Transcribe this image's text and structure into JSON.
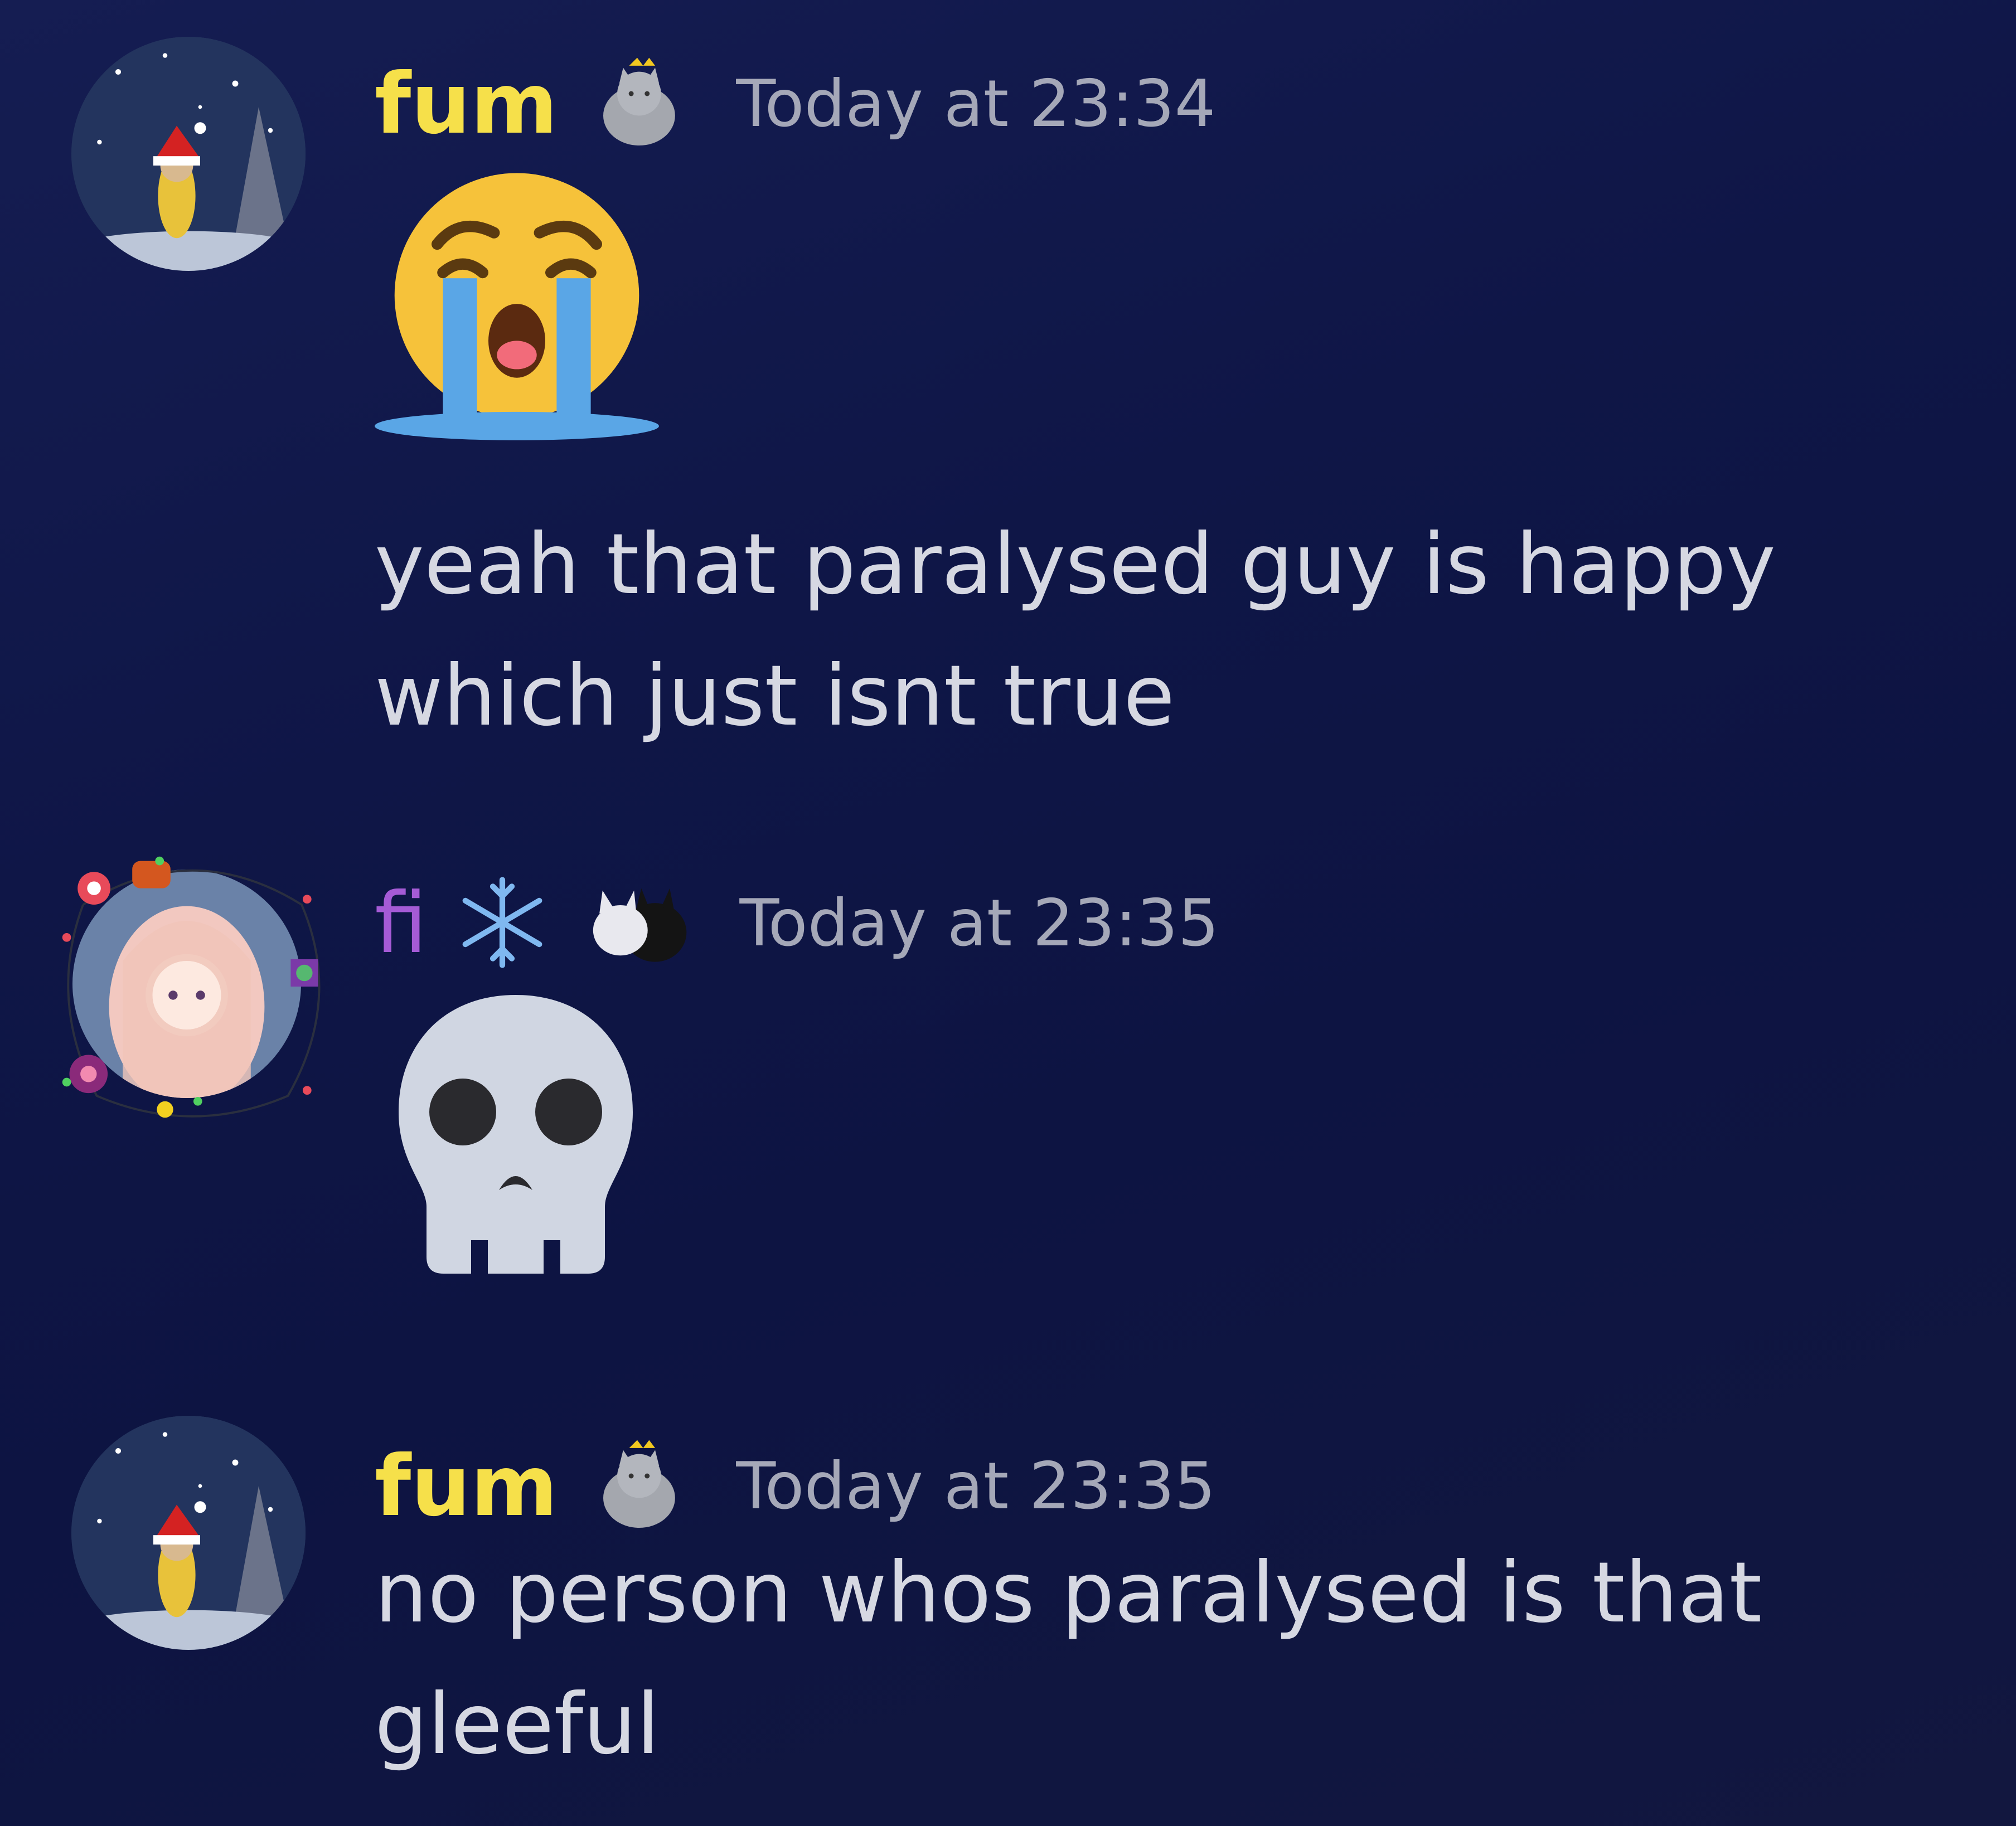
{
  "messages": [
    {
      "username": "fum",
      "badge_icon": "grey-cat-with-crown-icon",
      "timestamp": "Today at 23:34",
      "emoji": "loudly-crying-face-emoji",
      "text_lines": [
        "yeah that paralysed guy  is happy",
        "which just isnt true"
      ]
    },
    {
      "username": "fi",
      "badge_icons": [
        "snowflake-icon",
        "two-cats-icon"
      ],
      "timestamp": "Today at 23:35",
      "emoji": "skull-emoji"
    },
    {
      "username": "fum",
      "badge_icon": "grey-cat-with-crown-icon",
      "timestamp": "Today at 23:35",
      "text_lines": [
        "no person whos paralysed is that",
        "gleeful"
      ]
    }
  ],
  "colors": {
    "fum_name": "#f6e04a",
    "fi_name": "#a55bd6",
    "timestamp": "#a5a8b8",
    "text": "#d6d8e2",
    "background": "#0f1647"
  }
}
